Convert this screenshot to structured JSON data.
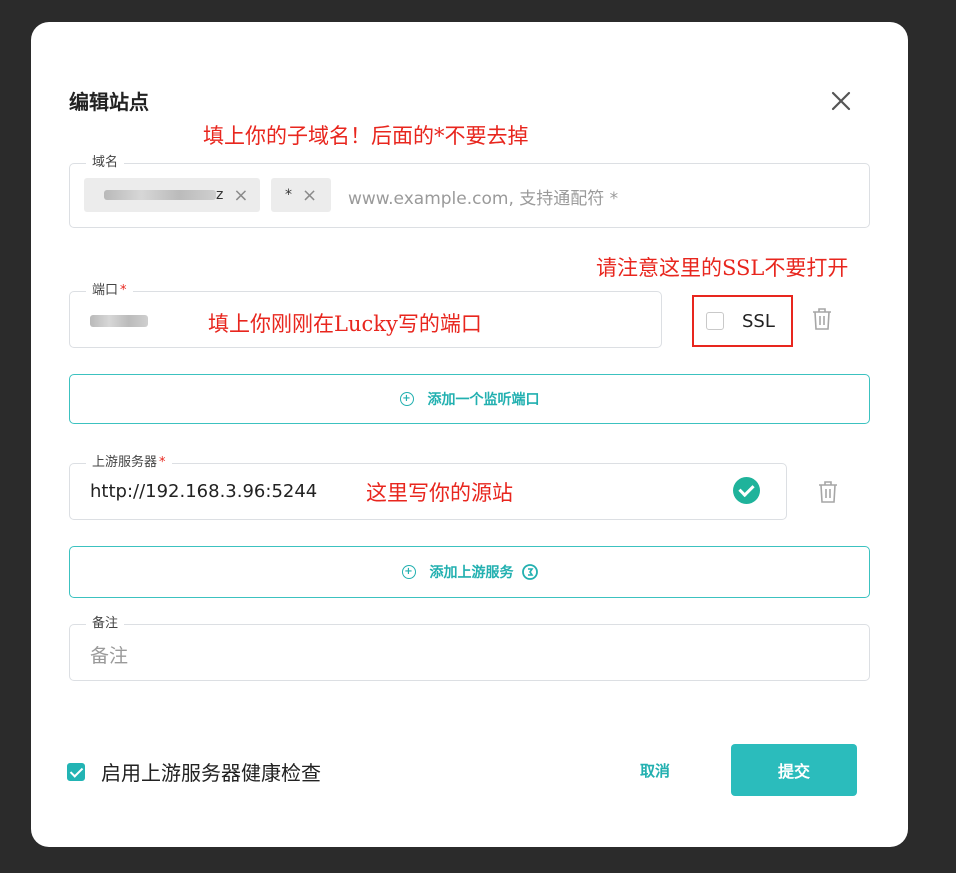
{
  "dialog": {
    "title": "编辑站点",
    "close_icon": "close-icon"
  },
  "annotations": {
    "domain_note": "填上你的子域名！后面的*不要去掉",
    "ssl_note": "请注意这里的SSL不要打开",
    "port_note": "填上你刚刚在Lucky写的端口",
    "upstream_note": "这里写你的源站"
  },
  "domain": {
    "label": "域名",
    "chip_1_text": "z",
    "chip_2_text": "*",
    "placeholder": "www.example.com, 支持通配符 *"
  },
  "port": {
    "label": "端口",
    "required_mark": "*",
    "ssl_label": "SSL",
    "ssl_enabled": false
  },
  "add_port_button": "添加一个监听端口",
  "upstream": {
    "label": "上游服务器",
    "required_mark": "*",
    "value": "http://192.168.3.96:5244",
    "status": "valid"
  },
  "add_upstream_button": "添加上游服务",
  "note": {
    "label": "备注",
    "placeholder": "备注"
  },
  "footer": {
    "health_check_label": "启用上游服务器健康检查",
    "health_check_enabled": true,
    "cancel_label": "取消",
    "submit_label": "提交"
  },
  "colors": {
    "accent": "#2bbcbc",
    "annotation": "#e8261e",
    "valid": "#1fb39b"
  }
}
